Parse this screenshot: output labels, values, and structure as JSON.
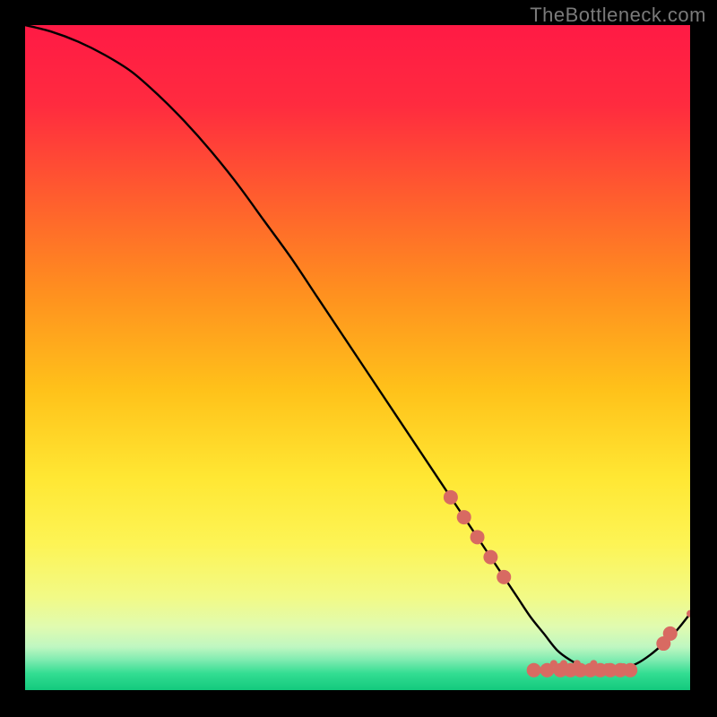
{
  "watermark": "TheBottleneck.com",
  "gradient": {
    "stops": [
      {
        "offset": 0.0,
        "color": "#ff1a45"
      },
      {
        "offset": 0.12,
        "color": "#ff2b3f"
      },
      {
        "offset": 0.25,
        "color": "#ff5a2f"
      },
      {
        "offset": 0.4,
        "color": "#ff8f1f"
      },
      {
        "offset": 0.55,
        "color": "#ffc21a"
      },
      {
        "offset": 0.68,
        "color": "#ffe733"
      },
      {
        "offset": 0.78,
        "color": "#fdf455"
      },
      {
        "offset": 0.86,
        "color": "#f2fa86"
      },
      {
        "offset": 0.905,
        "color": "#e0fbb0"
      },
      {
        "offset": 0.935,
        "color": "#bff7c1"
      },
      {
        "offset": 0.955,
        "color": "#7eebb0"
      },
      {
        "offset": 0.975,
        "color": "#33dd92"
      },
      {
        "offset": 1.0,
        "color": "#13c97d"
      }
    ]
  },
  "chart_data": {
    "type": "line",
    "title": "",
    "xlabel": "",
    "ylabel": "",
    "xlim": [
      0,
      100
    ],
    "ylim": [
      0,
      100
    ],
    "series": [
      {
        "name": "curve",
        "x": [
          0,
          4,
          8,
          12,
          16,
          20,
          24,
          28,
          32,
          36,
          40,
          44,
          48,
          52,
          56,
          60,
          64,
          68,
          72,
          74,
          76,
          78,
          80,
          82,
          84,
          86,
          88,
          90,
          92,
          94,
          96,
          98,
          100
        ],
        "y": [
          100,
          99,
          97.5,
          95.5,
          93,
          89.5,
          85.5,
          81,
          76,
          70.5,
          65,
          59,
          53,
          47,
          41,
          35,
          29,
          23,
          17,
          14,
          11,
          8.5,
          6,
          4.5,
          3.5,
          3,
          3,
          3.3,
          4,
          5.3,
          7,
          9,
          11.5
        ]
      }
    ],
    "markers": {
      "name": "highlight-points",
      "color": "#d86a62",
      "radius_major": 8,
      "radius_minor": 4,
      "anchors_major": [
        {
          "x": 64,
          "y": 29
        },
        {
          "x": 66,
          "y": 26
        },
        {
          "x": 68,
          "y": 23
        },
        {
          "x": 70,
          "y": 20
        },
        {
          "x": 72,
          "y": 17
        },
        {
          "x": 76.5,
          "y": 3
        },
        {
          "x": 78.5,
          "y": 3
        },
        {
          "x": 80.5,
          "y": 3
        },
        {
          "x": 82,
          "y": 3
        },
        {
          "x": 83.5,
          "y": 3
        },
        {
          "x": 85,
          "y": 3
        },
        {
          "x": 86.5,
          "y": 3
        },
        {
          "x": 88,
          "y": 3
        },
        {
          "x": 89.5,
          "y": 3
        },
        {
          "x": 91,
          "y": 3
        },
        {
          "x": 96,
          "y": 7
        },
        {
          "x": 97,
          "y": 8.5
        }
      ],
      "anchors_minor": [
        {
          "x": 79.5,
          "y": 4
        },
        {
          "x": 81,
          "y": 4
        },
        {
          "x": 83,
          "y": 4
        },
        {
          "x": 85.5,
          "y": 4
        },
        {
          "x": 87.5,
          "y": 3.5
        },
        {
          "x": 90,
          "y": 3.5
        },
        {
          "x": 100,
          "y": 11.5
        }
      ]
    }
  }
}
